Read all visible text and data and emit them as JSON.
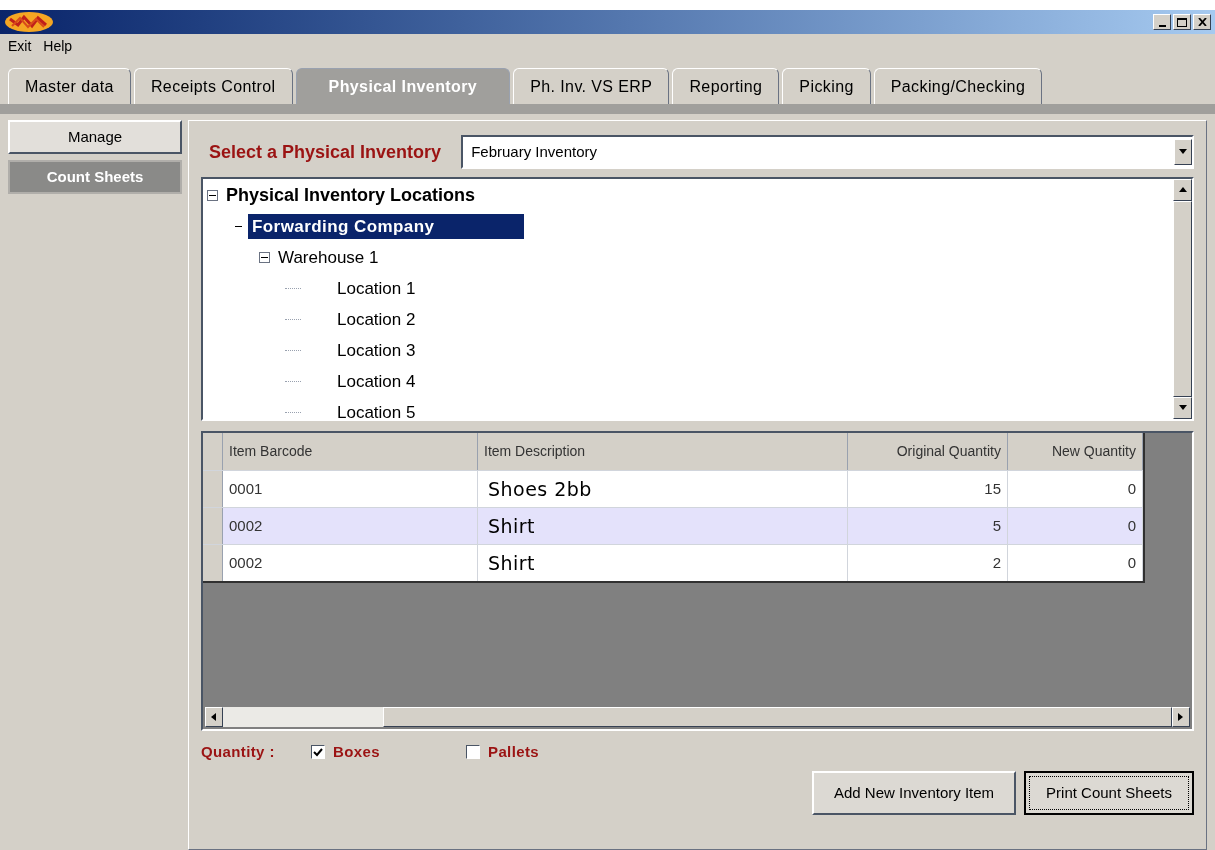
{
  "menu": [
    "Exit",
    "Help"
  ],
  "tabs": [
    {
      "label": "Master data",
      "selected": false
    },
    {
      "label": "Receipts Control",
      "selected": false
    },
    {
      "label": "Physical Inventory",
      "selected": true
    },
    {
      "label": "Ph. Inv. VS ERP",
      "selected": false
    },
    {
      "label": "Reporting",
      "selected": false
    },
    {
      "label": "Picking",
      "selected": false
    },
    {
      "label": "Packing/Checking",
      "selected": false
    }
  ],
  "sidebar": {
    "items": [
      {
        "label": "Manage",
        "selected": false
      },
      {
        "label": "Count Sheets",
        "selected": true
      }
    ]
  },
  "inventory_select": {
    "label": "Select a Physical Inventory",
    "value": "February Inventory"
  },
  "tree": [
    {
      "label": "Physical Inventory Locations",
      "expanded": true,
      "selected": false,
      "children": [
        {
          "label": "Forwarding Company",
          "expanded": true,
          "selected": true,
          "children": [
            {
              "label": "Warehouse 1",
              "expanded": true,
              "selected": false,
              "children": [
                {
                  "label": "Location 1",
                  "selected": false
                },
                {
                  "label": "Location 2",
                  "selected": false
                },
                {
                  "label": "Location 3",
                  "selected": false
                },
                {
                  "label": "Location 4",
                  "selected": false
                },
                {
                  "label": "Location 5",
                  "selected": false
                }
              ]
            }
          ]
        }
      ]
    }
  ],
  "table": {
    "columns": [
      "Item Barcode",
      "Item Description",
      "Original Quantity",
      "New Quantity"
    ],
    "rows": [
      {
        "cells": [
          "0001",
          "Shoes 2bb",
          "15",
          "0"
        ],
        "selected": false
      },
      {
        "cells": [
          "0002",
          "Shirt",
          "5",
          "0"
        ],
        "selected": true
      },
      {
        "cells": [
          "0002",
          "Shirt",
          "2",
          "0"
        ],
        "selected": false
      }
    ]
  },
  "quantity": {
    "label": "Quantity :",
    "options": [
      {
        "label": "Boxes",
        "checked": true
      },
      {
        "label": "Pallets",
        "checked": false
      }
    ]
  },
  "buttons": [
    "Add New Inventory Item",
    "Print Count Sheets"
  ]
}
